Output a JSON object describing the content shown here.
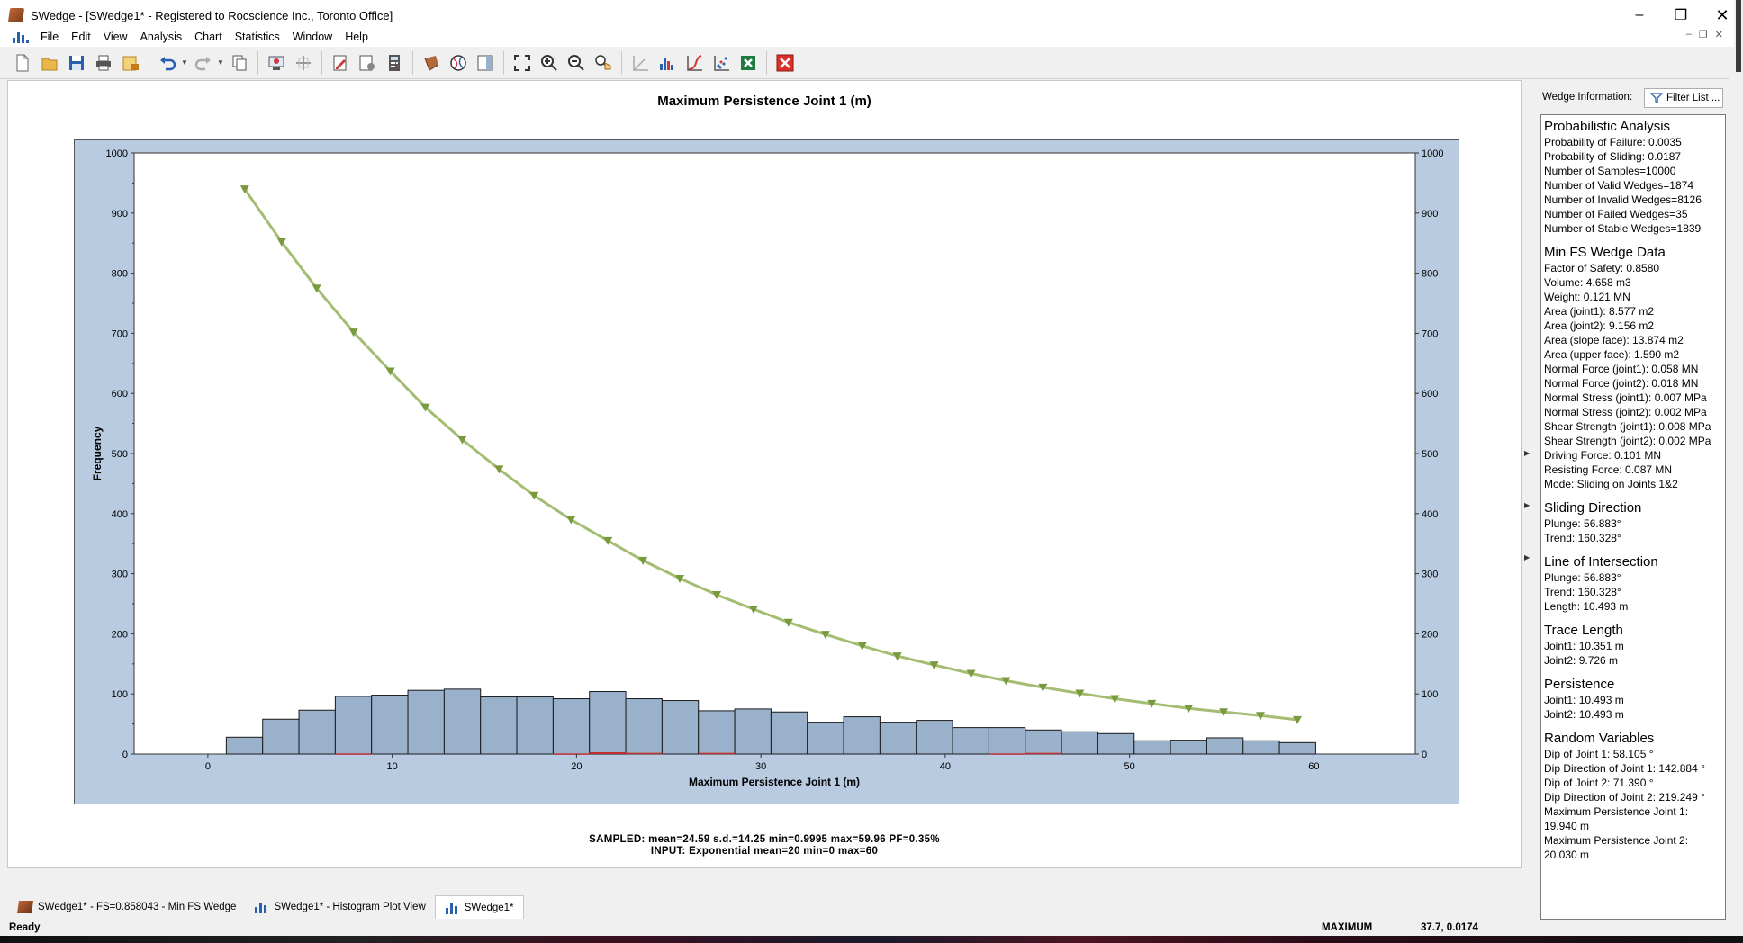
{
  "window": {
    "title": "SWedge - [SWedge1* - Registered to Rocscience Inc., Toronto Office]"
  },
  "menu": [
    "File",
    "Edit",
    "View",
    "Analysis",
    "Chart",
    "Statistics",
    "Window",
    "Help"
  ],
  "chart": {
    "title": "Maximum Persistence Joint 1 (m)",
    "stats_sampled": "SAMPLED: mean=24.59 s.d.=14.25 min=0.9995 max=59.96 PF=0.35%",
    "stats_input": "INPUT: Exponential mean=20 min=0 max=60"
  },
  "chart_data": {
    "type": "bar",
    "title": "Maximum Persistence Joint 1 (m)",
    "xlabel": "Maximum Persistence Joint 1 (m)",
    "ylabel": "Frequency",
    "xlim": [
      -4,
      65.5
    ],
    "ylim": [
      0,
      1000
    ],
    "x_ticks": [
      0,
      10,
      20,
      30,
      40,
      50,
      60
    ],
    "y_ticks": [
      0,
      100,
      200,
      300,
      400,
      500,
      600,
      700,
      800,
      900,
      1000
    ],
    "bin_start": 1,
    "bin_width": 1.97,
    "histogram": [
      28,
      58,
      73,
      96,
      98,
      106,
      108,
      95,
      95,
      92,
      104,
      92,
      89,
      72,
      75,
      70,
      53,
      62,
      53,
      56,
      44,
      44,
      40,
      37,
      34,
      22,
      23,
      27,
      22,
      19
    ],
    "failed_bins": [
      0,
      0,
      0,
      1,
      0,
      0,
      0,
      0,
      0,
      1,
      3,
      2,
      0,
      2,
      0,
      0,
      0,
      0,
      0,
      0,
      0,
      1,
      2,
      0,
      0,
      0,
      0,
      0,
      0,
      0
    ],
    "series": [
      {
        "x": [
          2.0,
          4.0,
          5.9,
          7.9,
          9.9,
          11.8,
          13.8,
          15.8,
          17.7,
          19.7,
          21.7,
          23.6,
          25.6,
          27.6,
          29.6,
          31.5,
          33.5,
          35.5,
          37.4,
          39.4,
          41.4,
          43.3,
          45.3,
          47.3,
          49.2,
          51.2,
          53.2,
          55.1,
          57.1,
          59.1
        ],
        "values": [
          940,
          852,
          775,
          702,
          637,
          577,
          523,
          474,
          430,
          390,
          355,
          322,
          292,
          265,
          241,
          219,
          199,
          180,
          163,
          148,
          134,
          122,
          111,
          101,
          92,
          84,
          76,
          70,
          64,
          57
        ]
      }
    ],
    "colors": {
      "bars": "#9ab1cc",
      "curve": "#a3bd72",
      "marker": "#7a9a3e",
      "failed": "#c03030",
      "frame": "#b9cbe0"
    },
    "grid": false,
    "legend": "none"
  },
  "info": {
    "header_label": "Wedge Information:",
    "filter_label": "Filter List ...",
    "sections": [
      {
        "title": "Probabilistic Analysis",
        "lines": [
          "Probability of Failure: 0.0035",
          "Probability of Sliding: 0.0187",
          "Number of Samples=10000",
          "Number of Valid Wedges=1874",
          "Number of Invalid Wedges=8126",
          "Number of Failed Wedges=35",
          "Number of Stable Wedges=1839"
        ]
      },
      {
        "title": "Min FS Wedge Data",
        "lines": [
          "Factor of Safety: 0.8580",
          "Volume: 4.658 m3",
          "Weight: 0.121 MN",
          "Area (joint1): 8.577 m2",
          "Area (joint2): 9.156 m2",
          "Area (slope face): 13.874 m2",
          "Area (upper face): 1.590 m2",
          "Normal Force (joint1): 0.058 MN",
          "Normal Force (joint2): 0.018 MN",
          "Normal Stress (joint1): 0.007 MPa",
          "Normal Stress (joint2): 0.002 MPa",
          "Shear Strength (joint1): 0.008 MPa",
          "Shear Strength (joint2): 0.002 MPa",
          "Driving Force: 0.101 MN",
          "Resisting Force: 0.087 MN",
          "Mode: Sliding on Joints 1&2"
        ]
      },
      {
        "title": "Sliding Direction",
        "lines": [
          "Plunge: 56.883°",
          "Trend: 160.328°"
        ]
      },
      {
        "title": "Line of Intersection",
        "lines": [
          "Plunge: 56.883°",
          "Trend: 160.328°",
          "Length: 10.493 m"
        ]
      },
      {
        "title": "Trace Length",
        "lines": [
          "Joint1: 10.351 m",
          "Joint2: 9.726 m"
        ]
      },
      {
        "title": "Persistence",
        "lines": [
          "Joint1: 10.493 m",
          "Joint2: 10.493 m"
        ]
      },
      {
        "title": "Random Variables",
        "lines": [
          "Dip of Joint 1: 58.105 °",
          "Dip Direction of Joint 1: 142.884 °",
          "Dip of Joint 2: 71.390 °",
          "Dip Direction of Joint 2: 219.249 °",
          "Maximum Persistence Joint 1: 19.940 m",
          "Maximum Persistence Joint 2: 20.030 m"
        ]
      }
    ]
  },
  "tabs": [
    {
      "label": "SWedge1* - FS=0.858043 - Min FS Wedge",
      "icon": "wedge-icon"
    },
    {
      "label": "SWedge1* - Histogram Plot View",
      "icon": "histogram-icon"
    },
    {
      "label": "SWedge1*",
      "icon": "histogram-icon"
    }
  ],
  "status": {
    "ready": "Ready",
    "mode": "MAXIMUM",
    "coords": "37.7, 0.0174"
  }
}
